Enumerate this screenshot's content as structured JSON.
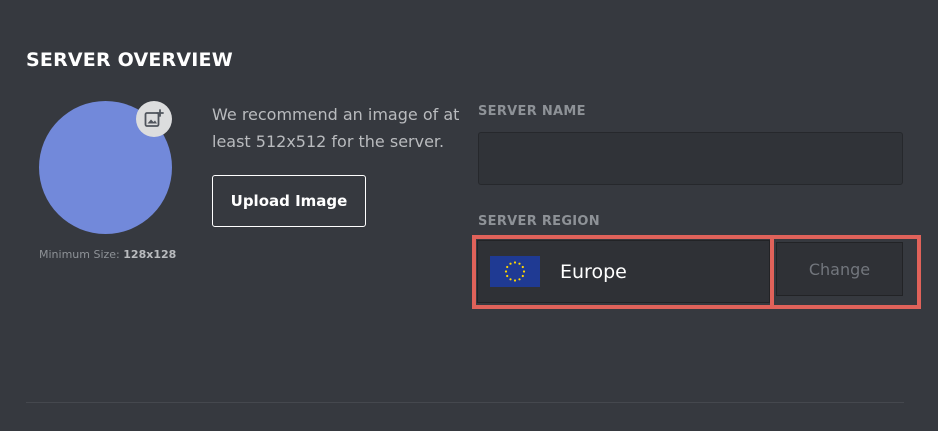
{
  "header": {
    "title": "SERVER OVERVIEW"
  },
  "avatar": {
    "color": "#7289da",
    "badge_icon": "add-image-icon",
    "min_size_label": "Minimum Size:",
    "min_size_value": "128x128"
  },
  "upload": {
    "recommendation": "We recommend an image of at least 512x512 for the server.",
    "button_label": "Upload Image"
  },
  "server_name": {
    "label": "SERVER NAME",
    "value": "",
    "placeholder": ""
  },
  "server_region": {
    "label": "SERVER REGION",
    "region": "Europe",
    "flag_icon": "eu-flag-icon",
    "change_label": "Change",
    "highlight_color": "#e0625a"
  },
  "colors": {
    "background": "#36393f",
    "field_background": "#303338",
    "blurple": "#7289da"
  }
}
